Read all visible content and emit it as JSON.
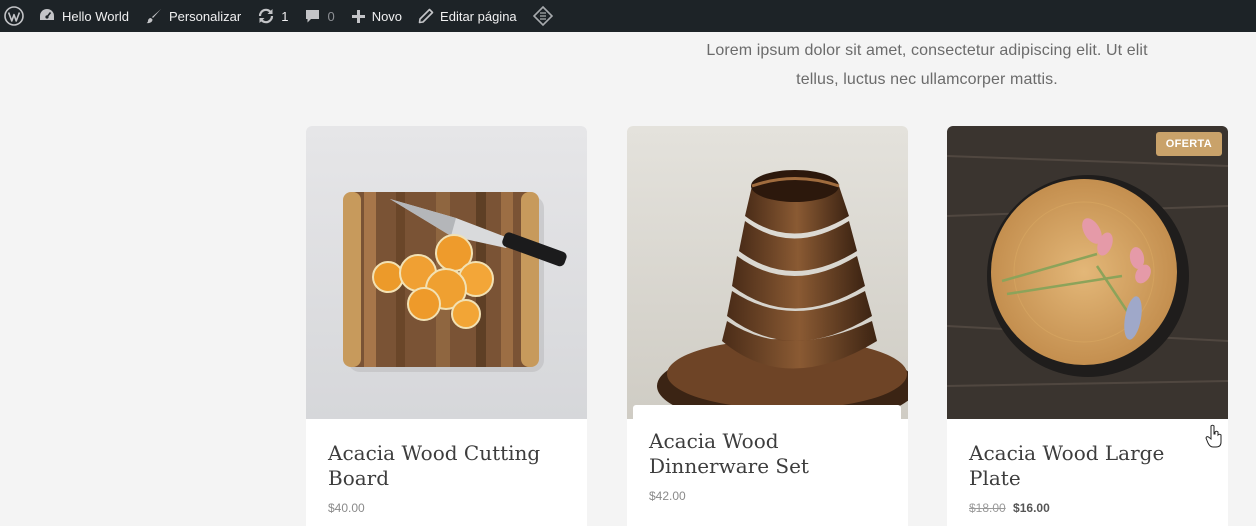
{
  "adminbar": {
    "site_name": "Hello World",
    "customize": "Personalizar",
    "updates_count": "1",
    "comments_count": "0",
    "new_label": "Novo",
    "edit_label": "Editar página"
  },
  "intro": {
    "line1": "Lorem ipsum dolor sit amet, consectetur adipiscing elit. Ut elit",
    "line2": "tellus, luctus nec ullamcorper mattis."
  },
  "products": [
    {
      "title": "Acacia Wood Cutting Board",
      "price": "$40.00"
    },
    {
      "title": "Acacia Wood Dinnerware Set",
      "price": "$42.00"
    },
    {
      "title": "Acacia Wood Large Plate",
      "old_price": "$18.00",
      "price": "$16.00",
      "badge": "OFERTA"
    }
  ],
  "colors": {
    "adminbar_bg": "#1d2327",
    "page_bg": "#f4f4f4",
    "badge_bg": "#c9a26a"
  }
}
